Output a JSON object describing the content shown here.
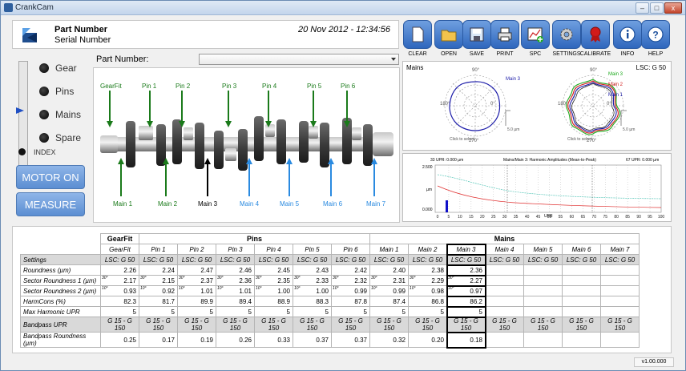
{
  "window": {
    "title": "CrankCam",
    "min": "–",
    "max": "□",
    "close": "x"
  },
  "header": {
    "part_label": "Part Number",
    "serial_label": "Serial Number",
    "datetime": "20 Nov 2012 - 12:34:56"
  },
  "toolbar": [
    {
      "label": "CLEAR",
      "icon": "document-icon",
      "color": "#ffffff"
    },
    {
      "label": "OPEN",
      "icon": "folder-icon",
      "color": "#f3c34c"
    },
    {
      "label": "SAVE",
      "icon": "floppy-icon",
      "color": "#d9e7f7"
    },
    {
      "label": "PRINT",
      "icon": "printer-icon",
      "color": "#e8e8e8"
    },
    {
      "label": "SPC",
      "icon": "chart-add-icon",
      "color": "#ffffff"
    },
    {
      "label": "SETTINGS",
      "icon": "gear-icon",
      "color": "#cfcfcf"
    },
    {
      "label": "CALIBRATE",
      "icon": "ribbon-icon",
      "color": "#d21a1a"
    },
    {
      "label": "INFO",
      "icon": "info-icon",
      "color": "#ffffff"
    },
    {
      "label": "HELP",
      "icon": "help-icon",
      "color": "#ffffff"
    }
  ],
  "left_panel": {
    "positions": [
      "Gear",
      "Pins",
      "Mains",
      "Spare"
    ],
    "index_label": "INDEX",
    "motor_button": "MOTOR ON",
    "measure_button": "MEASURE"
  },
  "part_number": {
    "label": "Part Number:",
    "value": ""
  },
  "crank_labels": {
    "top": [
      {
        "text": "GearFit",
        "color": "#1a7a1a"
      },
      {
        "text": "Pin 1",
        "color": "#1a7a1a"
      },
      {
        "text": "Pin 2",
        "color": "#1a7a1a"
      },
      {
        "text": "Pin 3",
        "color": "#1a7a1a"
      },
      {
        "text": "Pin 4",
        "color": "#1a7a1a"
      },
      {
        "text": "Pin 5",
        "color": "#1a7a1a"
      },
      {
        "text": "Pin 6",
        "color": "#1a7a1a"
      }
    ],
    "bottom": [
      {
        "text": "Main 1",
        "color": "#1a7a1a"
      },
      {
        "text": "Main 2",
        "color": "#1a7a1a"
      },
      {
        "text": "Main 3",
        "color": "#000000"
      },
      {
        "text": "Main 4",
        "color": "#2a8ae0"
      },
      {
        "text": "Main 5",
        "color": "#2a8ae0"
      },
      {
        "text": "Main 6",
        "color": "#2a8ae0"
      },
      {
        "text": "Main 7",
        "color": "#2a8ae0"
      }
    ]
  },
  "polar": {
    "title": "Mains",
    "lsc": "LSC: G 50",
    "left_legend": "Main 3",
    "right_legend": [
      "Main 3",
      "Main 2",
      "Main 1"
    ],
    "angles": [
      "90°",
      "0°",
      "180°",
      "270°"
    ],
    "hint": "Click to select.",
    "scale": "5.0 µm"
  },
  "harmonic": {
    "left_info": "33 UPR:  0.000 µm",
    "center_info": "Mains/Main 3:  Harmonic Amplitudes (Mean-to-Peak)",
    "right_info": "67 UPR:  0.000 µm",
    "y_ticks": [
      "2.500",
      "µm",
      "0.000"
    ],
    "x_ticks": [
      "0",
      "5",
      "10",
      "15",
      "20",
      "25",
      "30",
      "35",
      "40",
      "45",
      "50",
      "55",
      "60",
      "65",
      "70",
      "75",
      "80",
      "85",
      "90",
      "95",
      "100"
    ],
    "x_unit": "UPR"
  },
  "table": {
    "groups": {
      "gearfit": "GearFit",
      "pins": "Pins",
      "mains": "Mains"
    },
    "columns": [
      "GearFit",
      "Pin 1",
      "Pin 2",
      "Pin 3",
      "Pin 4",
      "Pin 5",
      "Pin 6",
      "Main 1",
      "Main 2",
      "Main 3",
      "Main 4",
      "Main 5",
      "Main 6",
      "Main 7"
    ],
    "rows": [
      {
        "label": "Settings",
        "gray": true,
        "values": [
          "LSC: G 50",
          "LSC: G 50",
          "LSC: G 50",
          "LSC: G 50",
          "LSC: G 50",
          "LSC: G 50",
          "LSC: G 50",
          "LSC: G 50",
          "LSC: G 50",
          "LSC: G 50",
          "LSC: G 50",
          "LSC: G 50",
          "LSC: G 50",
          "LSC: G 50"
        ]
      },
      {
        "label": "Roundness (µm)",
        "values": [
          "2.26",
          "2.24",
          "2.47",
          "2.46",
          "2.45",
          "2.43",
          "2.42",
          "2.40",
          "2.38",
          "2.36",
          "",
          "",
          "",
          ""
        ]
      },
      {
        "label": "Sector Roundness 1 (µm)",
        "sup": "30°",
        "values": [
          "2.17",
          "2.15",
          "2.37",
          "2.36",
          "2.35",
          "2.33",
          "2.32",
          "2.31",
          "2.29",
          "2.27",
          "",
          "",
          "",
          ""
        ]
      },
      {
        "label": "Sector Roundness 2 (µm)",
        "sup": "10°",
        "values": [
          "0.93",
          "0.92",
          "1.01",
          "1.01",
          "1.00",
          "1.00",
          "0.99",
          "0.99",
          "0.98",
          "0.97",
          "",
          "",
          "",
          ""
        ]
      },
      {
        "label": "HarmCons (%)",
        "values": [
          "82.3",
          "81.7",
          "89.9",
          "89.4",
          "88.9",
          "88.3",
          "87.8",
          "87.4",
          "86.8",
          "86.2",
          "",
          "",
          "",
          ""
        ]
      },
      {
        "label": "Max Harmonic UPR",
        "values": [
          "5",
          "5",
          "5",
          "5",
          "5",
          "5",
          "5",
          "5",
          "5",
          "5",
          "",
          "",
          "",
          ""
        ]
      },
      {
        "label": "Bandpass UPR",
        "gray": true,
        "values": [
          "G 15 - G 150",
          "G 15 - G 150",
          "G 15 - G 150",
          "G 15 - G 150",
          "G 15 - G 150",
          "G 15 - G 150",
          "G 15 - G 150",
          "G 15 - G 150",
          "G 15 - G 150",
          "G 15 - G 150",
          "G 15 - G 150",
          "G 15 - G 150",
          "G 15 - G 150",
          "G 15 - G 150"
        ]
      },
      {
        "label": "Bandpass Roundness (µm)",
        "values": [
          "0.25",
          "0.17",
          "0.19",
          "0.26",
          "0.33",
          "0.37",
          "0.37",
          "0.32",
          "0.20",
          "0.18",
          "",
          "",
          "",
          ""
        ]
      }
    ]
  },
  "version": "v1.00.000"
}
